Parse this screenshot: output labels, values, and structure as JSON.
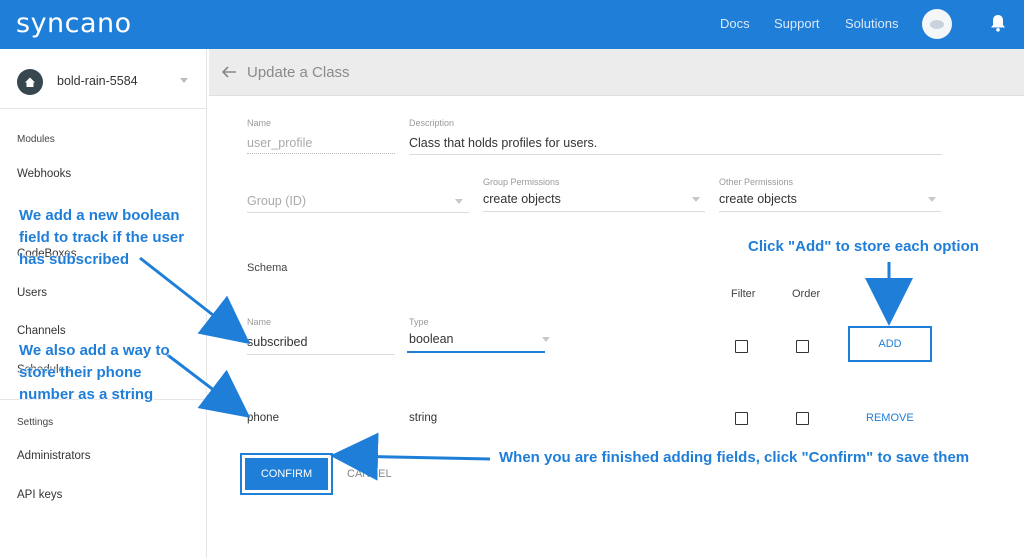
{
  "topbar": {
    "logo": "syncano",
    "nav": [
      "Docs",
      "Support",
      "Solutions"
    ],
    "icons": {
      "avatar": "user-avatar",
      "bell": "bell-icon"
    }
  },
  "sidebar": {
    "instance_name": "bold-rain-5584",
    "modules_heading": "Modules",
    "items": [
      "Webhooks",
      "CodeBoxes",
      "Users",
      "Channels",
      "Schedules"
    ],
    "settings_heading": "Settings",
    "settings_items": [
      "Administrators",
      "API keys"
    ]
  },
  "header": {
    "title": "Update a Class"
  },
  "form": {
    "name_label": "Name",
    "name_value": "user_profile",
    "description_label": "Description",
    "description_value": "Class that holds profiles for users.",
    "group_placeholder": "Group (ID)",
    "group_permissions_label": "Group Permissions",
    "group_permissions_value": "create objects",
    "other_permissions_label": "Other Permissions",
    "other_permissions_value": "create objects"
  },
  "schema": {
    "heading": "Schema",
    "filter_label": "Filter",
    "order_label": "Order",
    "new_field": {
      "name_label": "Name",
      "name_value": "subscribed",
      "type_label": "Type",
      "type_value": "boolean",
      "add_label": "ADD"
    },
    "fields": [
      {
        "name": "phone",
        "type": "string",
        "action": "REMOVE"
      }
    ]
  },
  "actions": {
    "confirm": "CONFIRM",
    "cancel": "CANCEL"
  },
  "annotations": {
    "add_field": "We add a new boolean field to track if the user has subscribed",
    "add_phone": "We also add a way to store their phone number as a string",
    "click_add": "Click \"Add\" to store each option",
    "finished": "When you are finished adding fields, click \"Confirm\" to save them"
  },
  "colors": {
    "brand": "#1f7ed8",
    "header_bg": "#ececec"
  }
}
